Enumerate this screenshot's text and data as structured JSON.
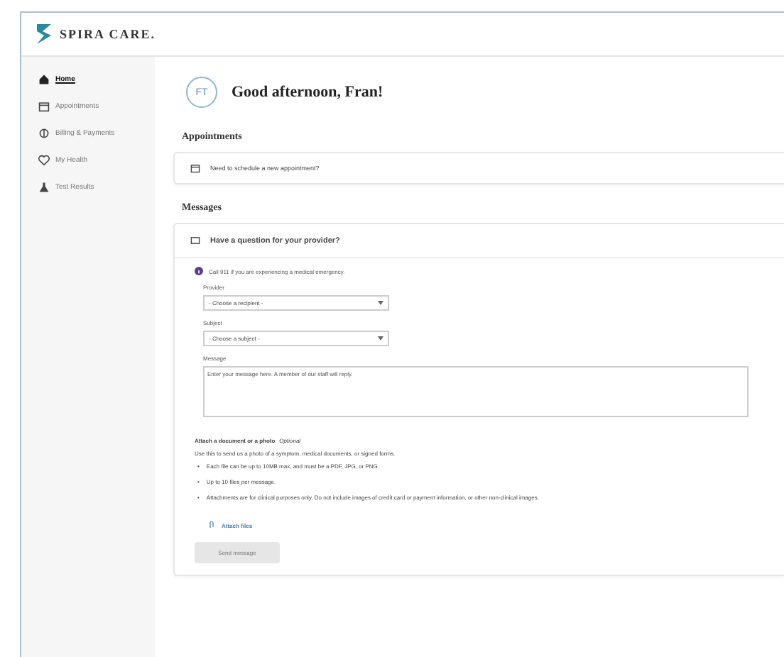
{
  "header": {
    "brand": "SPIRA CARE."
  },
  "sidebar": {
    "items": [
      {
        "label": "Home",
        "selected": true
      },
      {
        "label": "Appointments",
        "selected": false
      },
      {
        "label": "Billing & Payments",
        "selected": false
      },
      {
        "label": "My Health",
        "selected": false
      },
      {
        "label": "Test Results",
        "selected": false
      }
    ]
  },
  "greeting": {
    "initials": "FT",
    "text": "Good afternoon, Fran!"
  },
  "appointments": {
    "title": "Appointments",
    "prompt": "Need to schedule a new appointment?"
  },
  "messages": {
    "title": "Messages",
    "question": "Have a question for your provider?",
    "notice": "Call 911 if you are experiencing a medical emergency.",
    "fields": [
      {
        "kind": "select",
        "label": "Provider",
        "value": "- Choose a recipient -"
      },
      {
        "kind": "select",
        "label": "Subject",
        "value": "- Choose a subject -"
      },
      {
        "kind": "textarea",
        "label": "Message",
        "placeholder": "Enter your message here. A member of our staff will reply."
      }
    ],
    "attach": {
      "title": "Attach a document or a photo",
      "optional": "Optional",
      "description": "Use this to send us a photo of a symptom, medical documents, or signed forms.",
      "bullets": [
        {
          "marker": "•",
          "text": "Each file can be up to 10MB max, and must be a PDF, JPG, or PNG."
        },
        {
          "marker": "•",
          "text": "Up to 10 files per message."
        },
        {
          "marker": "•",
          "text": "Attachments are for clinical purposes only. Do not include images of credit card or payment information, or other non-clinical images."
        }
      ],
      "link": "Attach files"
    },
    "send": {
      "label": "Send message",
      "disabled": true
    }
  }
}
